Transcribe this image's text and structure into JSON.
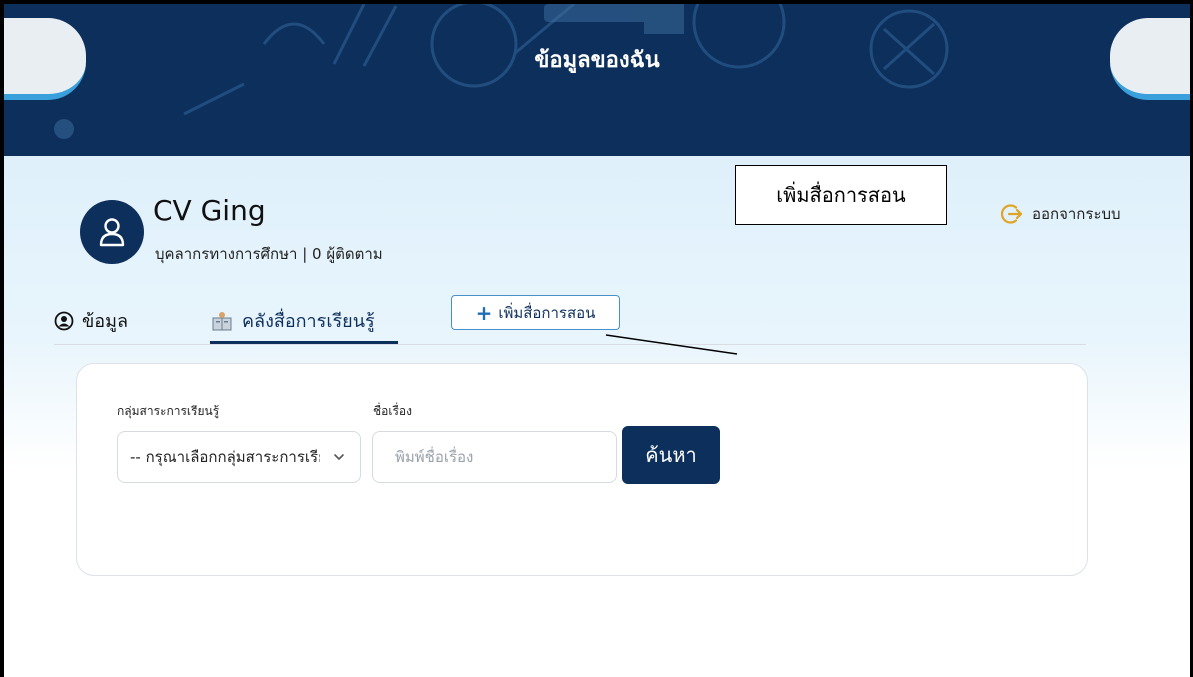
{
  "header": {
    "title": "ข้อมูลของฉัน"
  },
  "profile": {
    "name": "CV Ging",
    "subtitle": "บุคลากรทางการศึกษา | 0 ผู้ติดตาม",
    "avatar_icon": "user-icon"
  },
  "actions": {
    "logout_label": "ออกจากระบบ",
    "logout_icon": "logout-icon"
  },
  "tabs": [
    {
      "label": "ข้อมูล",
      "icon": "user-circle-icon",
      "active": false
    },
    {
      "label": "คลังสื่อการเรียนรู้",
      "icon": "book-icon",
      "active": true
    }
  ],
  "add_media": {
    "label": "เพิ่มสื่อการสอน",
    "icon": "plus-icon"
  },
  "callout": {
    "text": "เพิ่มสื่อการสอน"
  },
  "search": {
    "group_label": "กลุ่มสาระการเรียนรู้",
    "group_selected": "-- กรุณาเลือกกลุ่มสาระการเรียนรู้ --",
    "title_label": "ชื่อเรื่อง",
    "title_placeholder": "พิมพ์ชื่อเรื่อง",
    "title_value": "",
    "button_label": "ค้นหา"
  },
  "colors": {
    "primary": "#0d2f5c",
    "accent": "#3aa0db",
    "logout_icon": "#e0a526"
  }
}
